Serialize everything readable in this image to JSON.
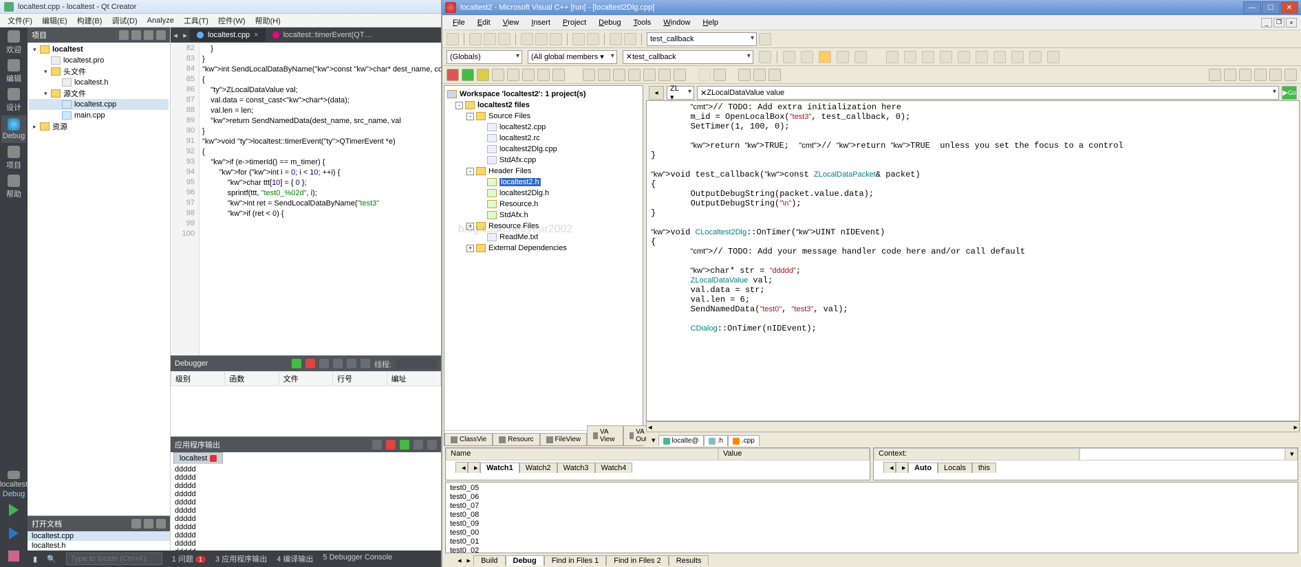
{
  "qt": {
    "title": "localtest.cpp - localtest - Qt Creator",
    "menu": [
      "文件(F)",
      "编辑(E)",
      "构建(B)",
      "调试(D)",
      "Analyze",
      "工具(T)",
      "控件(W)",
      "帮助(H)"
    ],
    "sidebar": [
      {
        "icon": "grid",
        "label": "欢迎"
      },
      {
        "icon": "edit",
        "label": "编辑"
      },
      {
        "icon": "design",
        "label": "设计"
      },
      {
        "icon": "bug",
        "label": "Debug",
        "active": true
      },
      {
        "icon": "proj",
        "label": "项目"
      },
      {
        "icon": "help",
        "label": "帮助"
      }
    ],
    "sidebar_bottom_label": "localtest",
    "sidebar_config": "Debug",
    "project_panel_title": "项目",
    "project_tree": [
      {
        "depth": 0,
        "arrow": "▾",
        "icon": "fold",
        "label": "localtest",
        "bold": true
      },
      {
        "depth": 1,
        "arrow": "",
        "icon": "file",
        "label": "localtest.pro"
      },
      {
        "depth": 1,
        "arrow": "▾",
        "icon": "fold",
        "label": "头文件"
      },
      {
        "depth": 2,
        "arrow": "",
        "icon": "file",
        "label": "localtest.h"
      },
      {
        "depth": 1,
        "arrow": "▾",
        "icon": "fold",
        "label": "源文件"
      },
      {
        "depth": 2,
        "arrow": "",
        "icon": "cpp",
        "label": "localtest.cpp",
        "sel": true
      },
      {
        "depth": 2,
        "arrow": "",
        "icon": "cpp",
        "label": "main.cpp"
      },
      {
        "depth": 0,
        "arrow": "▸",
        "icon": "fold",
        "label": "资源"
      }
    ],
    "openfiles_title": "打开文档",
    "openfiles": [
      {
        "label": "localtest.cpp",
        "sel": true
      },
      {
        "label": "localtest.h"
      }
    ],
    "tabs": [
      {
        "label": "localtest.cpp",
        "active": true,
        "dot": "blue",
        "close": true
      },
      {
        "label": "localtest::timerEvent(QT…",
        "active": false,
        "dot": "pink"
      }
    ],
    "code_start": 82,
    "code_lines": [
      "    }",
      "}",
      "",
      "int SendLocalDataByName(const char* dest_name, co",
      "{",
      "    ZLocalDataValue val;",
      "    val.data = const_cast<char*>(data);",
      "    val.len = len;",
      "    return SendNamedData(dest_name, src_name, val",
      "}",
      "",
      "void localtest::timerEvent(QTimerEvent *e)",
      "{",
      "    if (e->timerId() == m_timer) {",
      "        for (int i = 0; i < 10; ++i) {",
      "            char ttt[10] = { 0 };",
      "            sprintf(ttt, \"test0_%02d\", i);",
      "            int ret = SendLocalDataByName(\"test3\"",
      "            if (ret < 0) {"
    ],
    "debugger_title": "Debugger",
    "debugger_thread_label": "线程:",
    "dbg_cols": [
      "级别",
      "函数",
      "文件",
      "行号",
      "编址"
    ],
    "output_title": "应用程序输出",
    "output_tab": "localtest",
    "output_lines": [
      "ddddd",
      "ddddd",
      "ddddd",
      "ddddd",
      "ddddd",
      "ddddd",
      "ddddd",
      "ddddd",
      "ddddd",
      "ddddd",
      "ddddd"
    ],
    "status_search_ph": "Type to locate (Ctrl+K)",
    "status_items": [
      "1 问题",
      "3 应用程序输出",
      "4 编译输出",
      "5 Debugger Console"
    ],
    "status_badge": "1"
  },
  "vs": {
    "title": "localtest2 - Microsoft Visual C++ [run] - [localtest2Dlg.cpp]",
    "menu": [
      "File",
      "Edit",
      "View",
      "Insert",
      "Project",
      "Debug",
      "Tools",
      "Window",
      "Help"
    ],
    "combo_func": "test_callback",
    "combo_scope": "(Globals)",
    "combo_members": "(All global members ▾",
    "combo_func2": "test_callback",
    "nav_left": "ZL ▾",
    "nav_right": "ZLocalDataValue value",
    "nav_go": "Go",
    "workspace_title": "Workspace 'localtest2': 1 project(s)",
    "ws_tree": [
      {
        "d": 0,
        "pm": "-",
        "ic": "fold",
        "t": "localtest2 files",
        "bold": true
      },
      {
        "d": 1,
        "pm": "-",
        "ic": "fold",
        "t": "Source Files"
      },
      {
        "d": 2,
        "pm": "",
        "ic": "file",
        "t": "localtest2.cpp"
      },
      {
        "d": 2,
        "pm": "",
        "ic": "file",
        "t": "localtest2.rc"
      },
      {
        "d": 2,
        "pm": "",
        "ic": "file",
        "t": "localtest2Dlg.cpp"
      },
      {
        "d": 2,
        "pm": "",
        "ic": "file",
        "t": "StdAfx.cpp"
      },
      {
        "d": 1,
        "pm": "-",
        "ic": "fold",
        "t": "Header Files"
      },
      {
        "d": 2,
        "pm": "",
        "ic": "h",
        "t": "localtest2.h",
        "sel": true
      },
      {
        "d": 2,
        "pm": "",
        "ic": "h",
        "t": "localtest2Dlg.h"
      },
      {
        "d": 2,
        "pm": "",
        "ic": "h",
        "t": "Resource.h"
      },
      {
        "d": 2,
        "pm": "",
        "ic": "h",
        "t": "StdAfx.h"
      },
      {
        "d": 1,
        "pm": "+",
        "ic": "fold",
        "t": "Resource Files"
      },
      {
        "d": 2,
        "pm": "",
        "ic": "file",
        "t": "ReadMe.txt"
      },
      {
        "d": 1,
        "pm": "+",
        "ic": "fold",
        "t": "External Dependencies"
      }
    ],
    "ws_tabs": [
      "ClassVie",
      "Resourc",
      "FileView",
      "VA View",
      "VA Outl"
    ],
    "code": "\t// TODO: Add extra initialization here\n\tm_id = OpenLocalBox(\"test3\", test_callback, 0);\n\tSetTimer(1, 100, 0);\n\n\treturn TRUE;  // return TRUE  unless you set the focus to a control\n}\n\nvoid test_callback(const ZLocalDataPacket& packet)\n{\n\tOutputDebugString(packet.value.data);\n\tOutputDebugString(\"\\n\");\n}\n\nvoid CLocaltest2Dlg::OnTimer(UINT nIDEvent)\n{\n\t// TODO: Add your message handler code here and/or call default\n\n\tchar* str = \"ddddd\";\n\tZLocalDataValue val;\n\tval.data = str;\n\tval.len = 6;\n\tSendNamedData(\"test0\", \"test3\", val);\n\n\tCDialog::OnTimer(nIDEvent);",
    "ed_tabs": [
      "localte@",
      ".h",
      ".cpp"
    ],
    "watch_left_cols": [
      "Name",
      "Value"
    ],
    "watch_left_tabs": [
      "Watch1",
      "Watch2",
      "Watch3",
      "Watch4"
    ],
    "watch_right_label": "Context:",
    "watch_right_tabs": [
      "Auto",
      "Locals",
      "this"
    ],
    "out_lines": [
      "test0_05",
      "test0_06",
      "test0_07",
      "test0_08",
      "test0_09",
      "test0_00",
      "test0_01",
      "test0_02"
    ],
    "out_tabs": [
      "Build",
      "Debug",
      "Find in Files 1",
      "Find in Files 2",
      "Results"
    ],
    "watermark": "blog.csdn.net/year2002"
  }
}
